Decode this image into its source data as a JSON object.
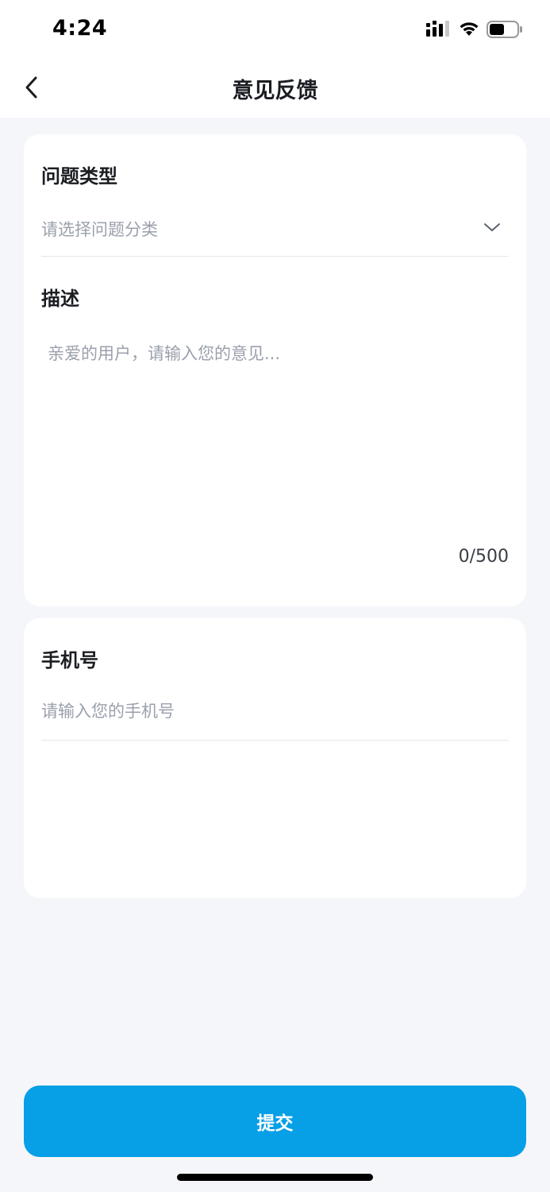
{
  "status_bar": {
    "time": "4:24",
    "icons": [
      "signal-icon",
      "wifi-icon",
      "battery-icon"
    ]
  },
  "nav": {
    "back_icon": "chevron-left-icon",
    "title": "意见反馈"
  },
  "feedback_card": {
    "type_label": "问题类型",
    "type_placeholder": "请选择问题分类",
    "type_icon": "chevron-down-icon",
    "desc_label": "描述",
    "desc_placeholder": "亲爱的用户，请输入您的意见...",
    "desc_value": "",
    "char_count": "0/500"
  },
  "phone_card": {
    "label": "手机号",
    "placeholder": "请输入您的手机号",
    "value": ""
  },
  "submit": {
    "label": "提交"
  },
  "colors": {
    "accent": "#079fe6",
    "background": "#f5f6fa",
    "placeholder": "#9aa0ac",
    "divider": "#e3e5ea"
  }
}
